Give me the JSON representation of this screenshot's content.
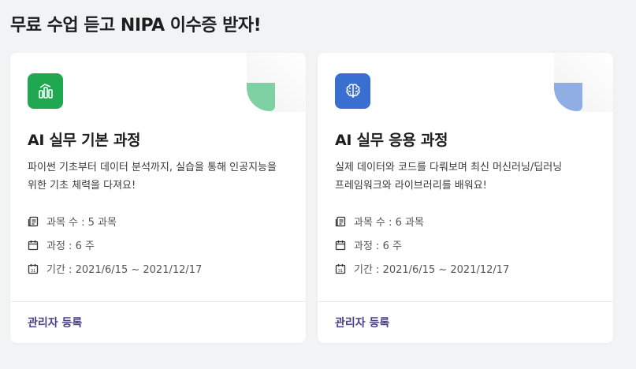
{
  "page": {
    "title": "무료 수업 듣고 NIPA 이수증 받자!"
  },
  "courses": [
    {
      "icon": "bar-chart-icon",
      "icon_bg": "#1fa84f",
      "corner_color": "#7fd0a3",
      "title": "AI 실무 기본 과정",
      "desc_line1": "파이썬 기초부터 데이터 분석까지, 실습을 통해 인공지능을",
      "desc_line2": "위한 기초 체력을 다져요!",
      "count": "과목 수 : 5 과목",
      "duration": "과정 : 6 주",
      "period": "기간 : 2021/6/15 ~ 2021/12/17",
      "action": "관리자 등록"
    },
    {
      "icon": "brain-icon",
      "icon_bg": "#3a6fd2",
      "corner_color": "#8eaee4",
      "title": "AI 실무 응용 과정",
      "desc_line1": "실제 데이터와 코드를 다뤄보며 최신 머신러닝/딥러닝",
      "desc_line2": "프레임워크와 라이브러리를 배워요!",
      "count": "과목 수 : 6 과목",
      "duration": "과정 : 6 주",
      "period": "기간 : 2021/6/15 ~ 2021/12/17",
      "action": "관리자 등록"
    }
  ]
}
